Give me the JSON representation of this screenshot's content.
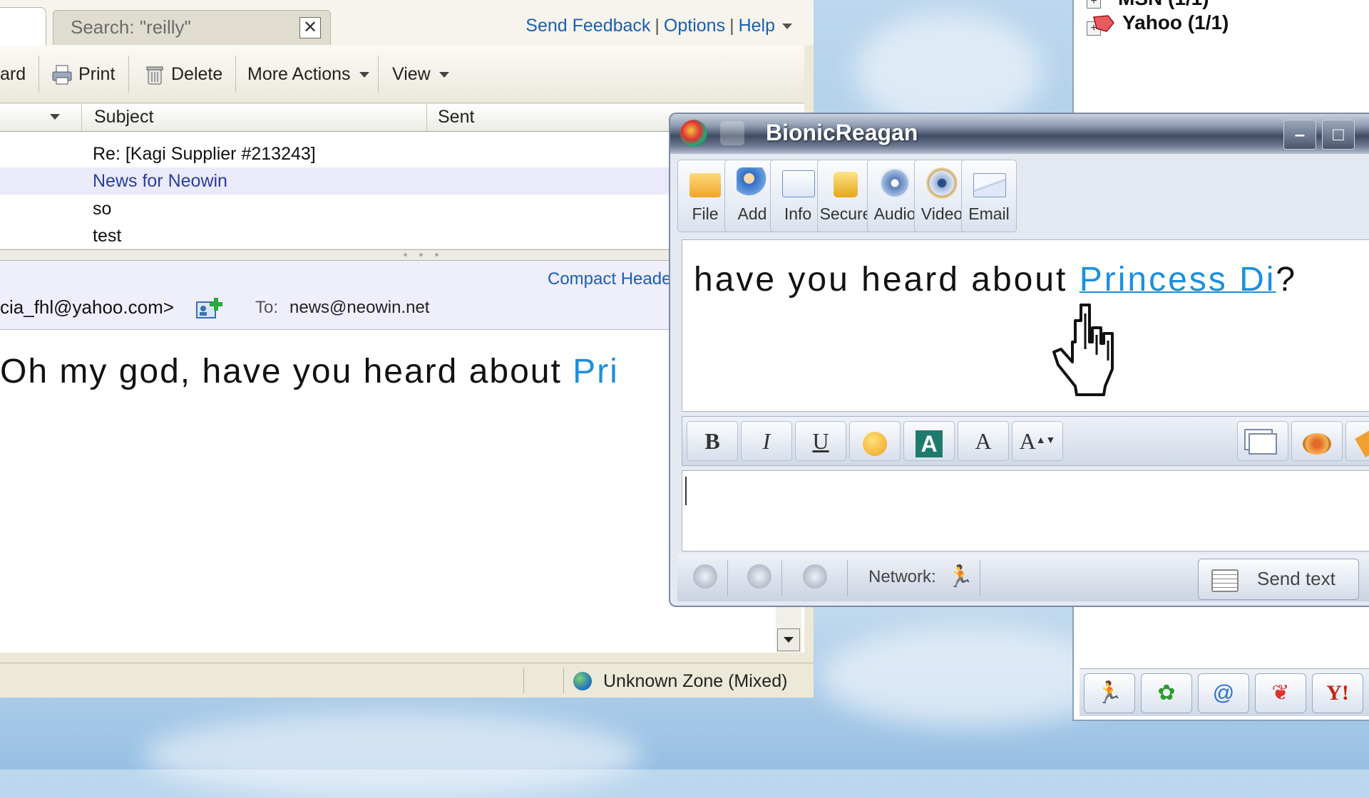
{
  "mail": {
    "search_tab": "Search: \"reilly\"",
    "close_glyph": "✕",
    "links": {
      "feedback": "Send Feedback",
      "options": "Options",
      "help": "Help",
      "sep": "|"
    },
    "toolbar": {
      "forward": "ard",
      "print": "Print",
      "delete": "Delete",
      "more_actions": "More Actions",
      "view": "View"
    },
    "columns": {
      "subject": "Subject",
      "sent": "Sent"
    },
    "messages": [
      {
        "subject": "Re: [Kagi Supplier #213243]"
      },
      {
        "subject": "News for Neowin"
      },
      {
        "subject": "so"
      },
      {
        "subject": "test"
      }
    ],
    "selected_color": "#ebeafb",
    "reading": {
      "compact_header": "Compact Heade",
      "from": "cia_fhl@yahoo.com>",
      "to_label": "To:",
      "to_value": "news@neowin.net",
      "body_text": "Oh my god, have you heard about ",
      "body_link": "Pri"
    },
    "status": {
      "zone": "Unknown Zone (Mixed)"
    }
  },
  "buddy": {
    "groups": [
      {
        "label": "MSN (1/1)"
      },
      {
        "label": "Yahoo (1/1)"
      }
    ],
    "bottom_icons": [
      "running-man-icon",
      "flower-icon",
      "spiral-icon",
      "butterfly-icon",
      "yahoo-icon"
    ]
  },
  "chat": {
    "title": "BionicReagan",
    "toolbar": {
      "file": "File",
      "add": "Add",
      "info": "Info",
      "secure": "Secure",
      "audio": "Audio",
      "video": "Video",
      "email": "Email"
    },
    "message_text": "have you heard about ",
    "message_link": "Princess Di",
    "message_end": "?",
    "format": {
      "bold": "B",
      "italic": "I",
      "underline": "U",
      "font_color": "A",
      "font": "A",
      "font_size": "A"
    },
    "network_label": "Network:",
    "send_label": "Send text",
    "link_color": "#1b8fe0"
  }
}
